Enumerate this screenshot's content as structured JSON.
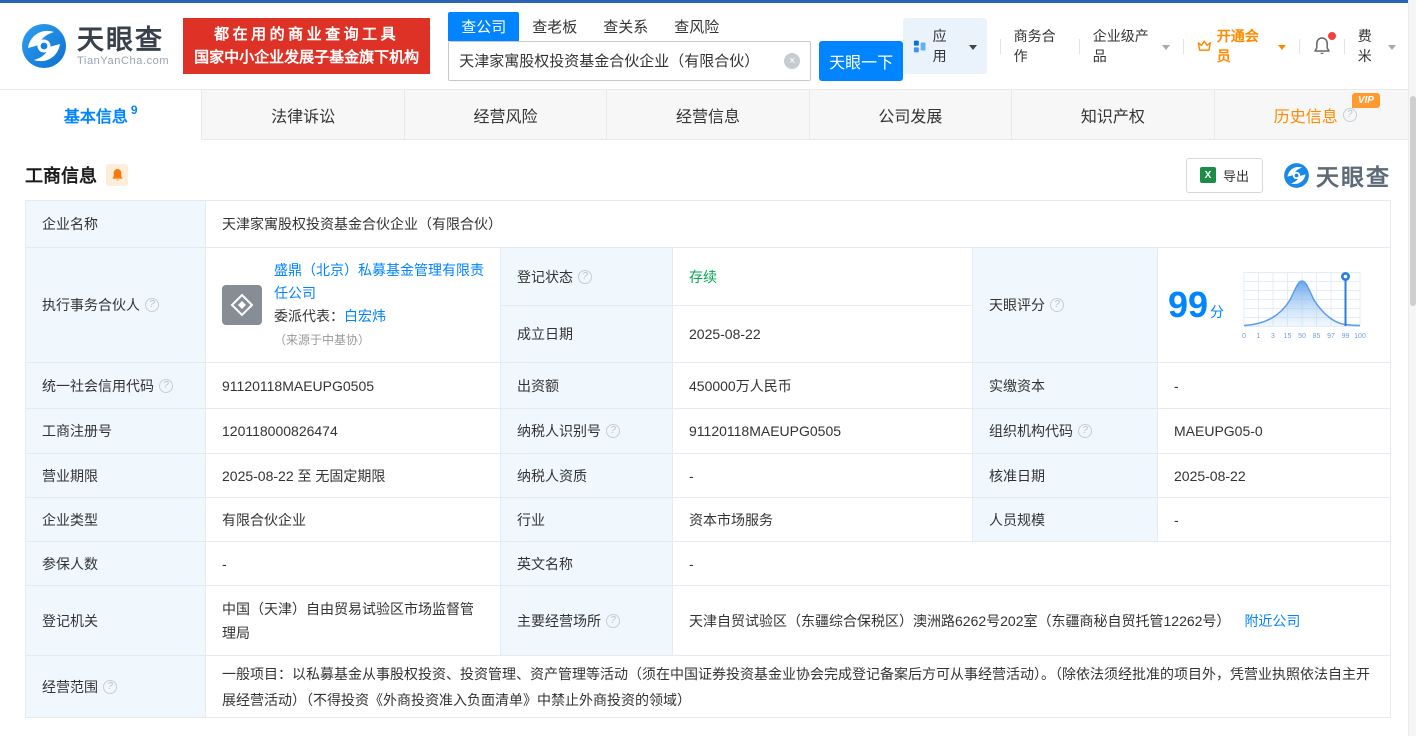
{
  "colors": {
    "accent_blue": "#0084ff",
    "accent_orange": "#ff8a00",
    "status_green": "#00a854",
    "brand_red": "#df3227"
  },
  "header": {
    "logo": {
      "brand": "天眼查",
      "domain": "TianYanCha.com"
    },
    "slogan": {
      "line1": "都在用的商业查询工具",
      "line2": "国家中小企业发展子基金旗下机构"
    },
    "search": {
      "tabs": [
        {
          "label": "查公司",
          "active": true
        },
        {
          "label": "查老板",
          "active": false
        },
        {
          "label": "查关系",
          "active": false
        },
        {
          "label": "查风险",
          "active": false
        }
      ],
      "value": "天津家寓股权投资基金合伙企业（有限合伙）",
      "button": "天眼一下"
    },
    "nav": {
      "apps": "应用",
      "business_cooperation": "商务合作",
      "enterprise_products": "企业级产品",
      "open_vip": "开通会员",
      "user": "费米"
    }
  },
  "tabs": [
    {
      "label": "基本信息",
      "count": "9",
      "active": true
    },
    {
      "label": "法律诉讼"
    },
    {
      "label": "经营风险"
    },
    {
      "label": "经营信息"
    },
    {
      "label": "公司发展"
    },
    {
      "label": "知识产权"
    },
    {
      "label": "历史信息",
      "vip_badge": "VIP"
    }
  ],
  "section": {
    "title": "工商信息",
    "export_label": "导出",
    "watermark_brand": "天眼查"
  },
  "table": {
    "company_name": {
      "label": "企业名称",
      "value": "天津家寓股权投资基金合伙企业（有限合伙）"
    },
    "partner": {
      "label": "执行事务合伙人",
      "company": "盛鼎（北京）私募基金管理有限责任公司",
      "rep_label": "委派代表：",
      "rep_name": "白宏炜",
      "rep_source": "（来源于中基协）"
    },
    "reg_status": {
      "label": "登记状态",
      "value": "存续"
    },
    "est_date": {
      "label": "成立日期",
      "value": "2025-08-22"
    },
    "score": {
      "label": "天眼评分",
      "value": "99",
      "unit": "分",
      "axis": [
        "0",
        "1",
        "3",
        "15",
        "50",
        "85",
        "97",
        "99",
        "100"
      ]
    },
    "credit_code": {
      "label": "统一社会信用代码",
      "value": "91120118MAEUPG0505"
    },
    "capital": {
      "label": "出资额",
      "value": "450000万人民币"
    },
    "paid_capital": {
      "label": "实缴资本",
      "value": "-"
    },
    "reg_number": {
      "label": "工商注册号",
      "value": "120118000826474"
    },
    "taxpayer_id": {
      "label": "纳税人识别号",
      "value": "91120118MAEUPG0505"
    },
    "org_code": {
      "label": "组织机构代码",
      "value": "MAEUPG05-0"
    },
    "business_term": {
      "label": "营业期限",
      "value": "2025-08-22 至 无固定期限"
    },
    "taxpayer_quality": {
      "label": "纳税人资质",
      "value": "-"
    },
    "approval_date": {
      "label": "核准日期",
      "value": "2025-08-22"
    },
    "company_type": {
      "label": "企业类型",
      "value": "有限合伙企业"
    },
    "industry": {
      "label": "行业",
      "value": "资本市场服务"
    },
    "staff_size": {
      "label": "人员规模",
      "value": "-"
    },
    "insured_count": {
      "label": "参保人数",
      "value": "-"
    },
    "english_name": {
      "label": "英文名称",
      "value": "-"
    },
    "reg_authority": {
      "label": "登记机关",
      "value": "中国（天津）自由贸易试验区市场监督管理局"
    },
    "business_address": {
      "label": "主要经营场所",
      "value": "天津自贸试验区（东疆综合保税区）澳洲路6262号202室（东疆商秘自贸托管12262号）",
      "nearby_link": "附近公司"
    },
    "business_scope": {
      "label": "经营范围",
      "value": "一般项目：以私募基金从事股权投资、投资管理、资产管理等活动（须在中国证券投资基金业协会完成登记备案后方可从事经营活动）。（除依法须经批准的项目外，凭营业执照依法自主开展经营活动）（不得投资《外商投资准入负面清单》中禁止外商投资的领域）"
    }
  }
}
